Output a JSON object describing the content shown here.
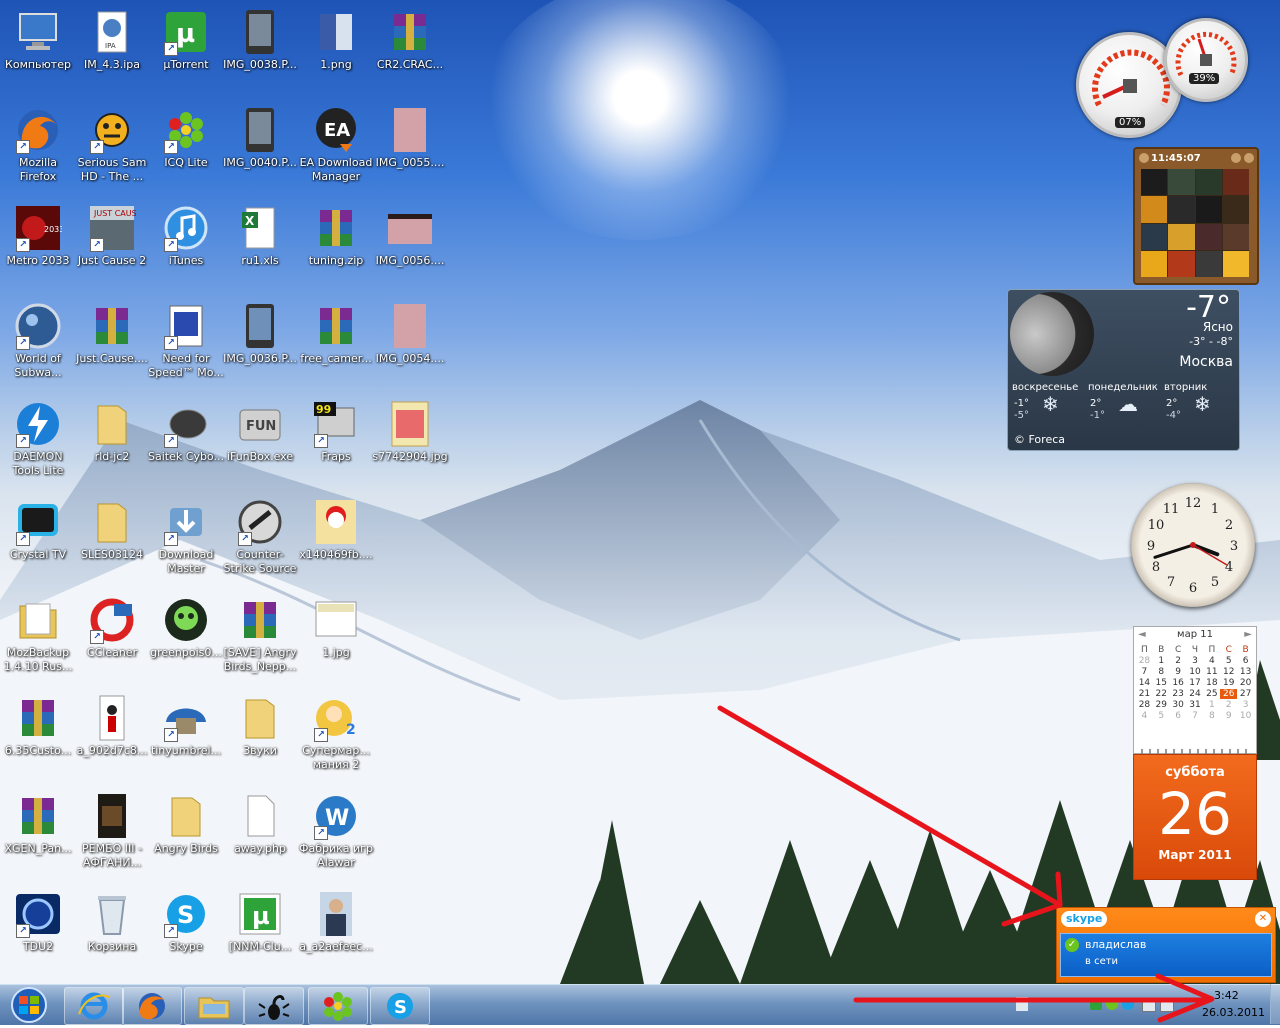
{
  "desktop": {
    "icons": [
      {
        "label": "Компьютер"
      },
      {
        "label": "IM_4.3.ipa"
      },
      {
        "label": "µTorrent"
      },
      {
        "label": "IMG_0038.P..."
      },
      {
        "label": "1.png"
      },
      {
        "label": "CR2.CRAC..."
      },
      {
        "label": "Mozilla Firefox"
      },
      {
        "label": "Serious Sam HD - The ..."
      },
      {
        "label": "ICQ Lite"
      },
      {
        "label": "IMG_0040.P..."
      },
      {
        "label": "EA Download Manager"
      },
      {
        "label": "IMG_0055...."
      },
      {
        "label": "Metro 2033"
      },
      {
        "label": "Just Cause 2"
      },
      {
        "label": "iTunes"
      },
      {
        "label": "ru1.xls"
      },
      {
        "label": "tuning.zip"
      },
      {
        "label": "IMG_0056...."
      },
      {
        "label": "World of Subwa..."
      },
      {
        "label": "Just.Cause...."
      },
      {
        "label": "Need for Speed™ Mo..."
      },
      {
        "label": "IMG_0036.P..."
      },
      {
        "label": "free_camer..."
      },
      {
        "label": "IMG_0054...."
      },
      {
        "label": "DAEMON Tools Lite"
      },
      {
        "label": "rld-jc2"
      },
      {
        "label": "Saitek Cybo..."
      },
      {
        "label": "iFunBox.exe"
      },
      {
        "label": "Fraps"
      },
      {
        "label": "s7742904.jpg"
      },
      {
        "label": "Crystal TV"
      },
      {
        "label": "SLES03124"
      },
      {
        "label": "Download Master"
      },
      {
        "label": "Counter-Strike Source"
      },
      {
        "label": "x140469fb...."
      },
      {
        "label": "MozBackup 1.4.10 Rus..."
      },
      {
        "label": "CCleaner"
      },
      {
        "label": "greenpois0..."
      },
      {
        "label": "[SAVE] Angry Birds_Nepp..."
      },
      {
        "label": "1.jpg"
      },
      {
        "label": "6.35Custo..."
      },
      {
        "label": "a_902d7c8..."
      },
      {
        "label": "tinyumbrel..."
      },
      {
        "label": "Звуки"
      },
      {
        "label": "Супермар... мания 2"
      },
      {
        "label": "XGEN_Pan..."
      },
      {
        "label": "РЕМБО III - АФГАНИ..."
      },
      {
        "label": "Angry Birds"
      },
      {
        "label": "away.php"
      },
      {
        "label": "Фабрика игр Alawar"
      },
      {
        "label": "TDU2"
      },
      {
        "label": "Корзина"
      },
      {
        "label": "Skype"
      },
      {
        "label": "[NNM-Clu..."
      },
      {
        "label": "a_a2aefeec..."
      }
    ]
  },
  "gadgets": {
    "cpu": {
      "cpu_value": "07%",
      "ram_value": "39%"
    },
    "puzzle": {
      "time": "11:45:07"
    },
    "weather": {
      "temperature": "-7°",
      "condition": "Ясно",
      "high_low": "-3° - -8°",
      "city": "Москва",
      "forecast": [
        {
          "day": "воскресенье",
          "high": "-1°",
          "low": "-5°"
        },
        {
          "day": "понедельник",
          "high": "2°",
          "low": "-1°"
        },
        {
          "day": "вторник",
          "high": "2°",
          "low": "-4°"
        }
      ],
      "provider": "© Foreca"
    },
    "clock": {
      "hour": 3,
      "minute": 42
    },
    "calendar": {
      "month_title": "мар 11",
      "weekday_headers": [
        "П",
        "В",
        "С",
        "Ч",
        "П",
        "С",
        "В"
      ],
      "weeks": [
        [
          "28",
          "1",
          "2",
          "3",
          "4",
          "5",
          "6"
        ],
        [
          "7",
          "8",
          "9",
          "10",
          "11",
          "12",
          "13"
        ],
        [
          "14",
          "15",
          "16",
          "17",
          "18",
          "19",
          "20"
        ],
        [
          "21",
          "22",
          "23",
          "24",
          "25",
          "26",
          "27"
        ],
        [
          "28",
          "29",
          "30",
          "31",
          "1",
          "2",
          "3"
        ],
        [
          "4",
          "5",
          "6",
          "7",
          "8",
          "9",
          "10"
        ]
      ],
      "today": "26",
      "weekday": "суббота",
      "month_year": "Март 2011"
    }
  },
  "skype_popup": {
    "logo": "skype",
    "contact_name": "владислав",
    "contact_status": "в сети",
    "close": "✕"
  },
  "taskbar": {
    "pinned": [
      "ie-icon",
      "firefox-icon",
      "explorer-icon",
      "scorpion-icon",
      "icq-icon",
      "skype-icon"
    ],
    "time": "3:42",
    "date": "26.03.2011"
  },
  "colors": {
    "annotation": "#e8141c",
    "calendar_accent": "#e85a0d",
    "skype_orange": "#f57e0e",
    "skype_blue": "#0b66d1"
  }
}
